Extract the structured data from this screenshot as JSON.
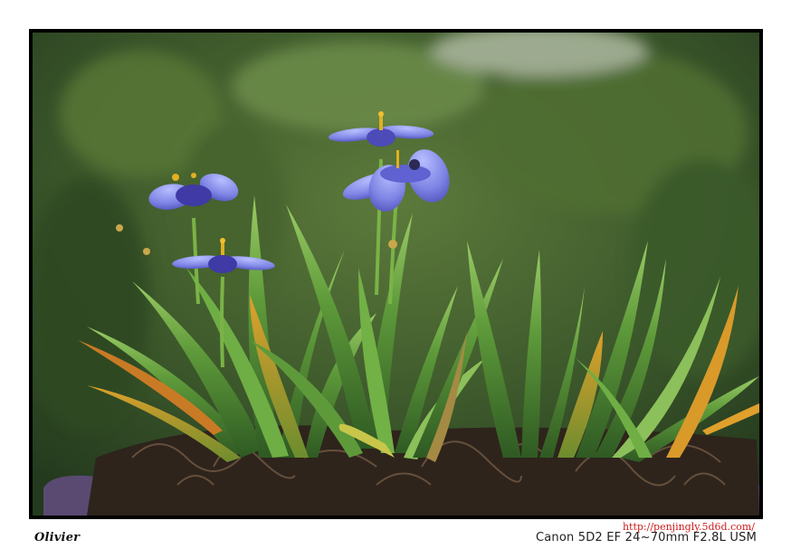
{
  "photo": {
    "subject": "blue-eyed grass flowers in a pot",
    "colors": {
      "background_blur": "#3f5a2c",
      "leaf": "#5e9a3a",
      "leaf_light": "#8cc05a",
      "leaf_tip": "#d99a2a",
      "petal": "#7f86e6",
      "petal_dark": "#3f3aa6",
      "soil": "#2e241c",
      "pot": "#5a4a72"
    }
  },
  "caption": {
    "author": "Olivier",
    "camera": "Canon 5D2  EF 24~70mm F2.8L  USM",
    "url": "http://penjingly.5d6d.com/"
  }
}
